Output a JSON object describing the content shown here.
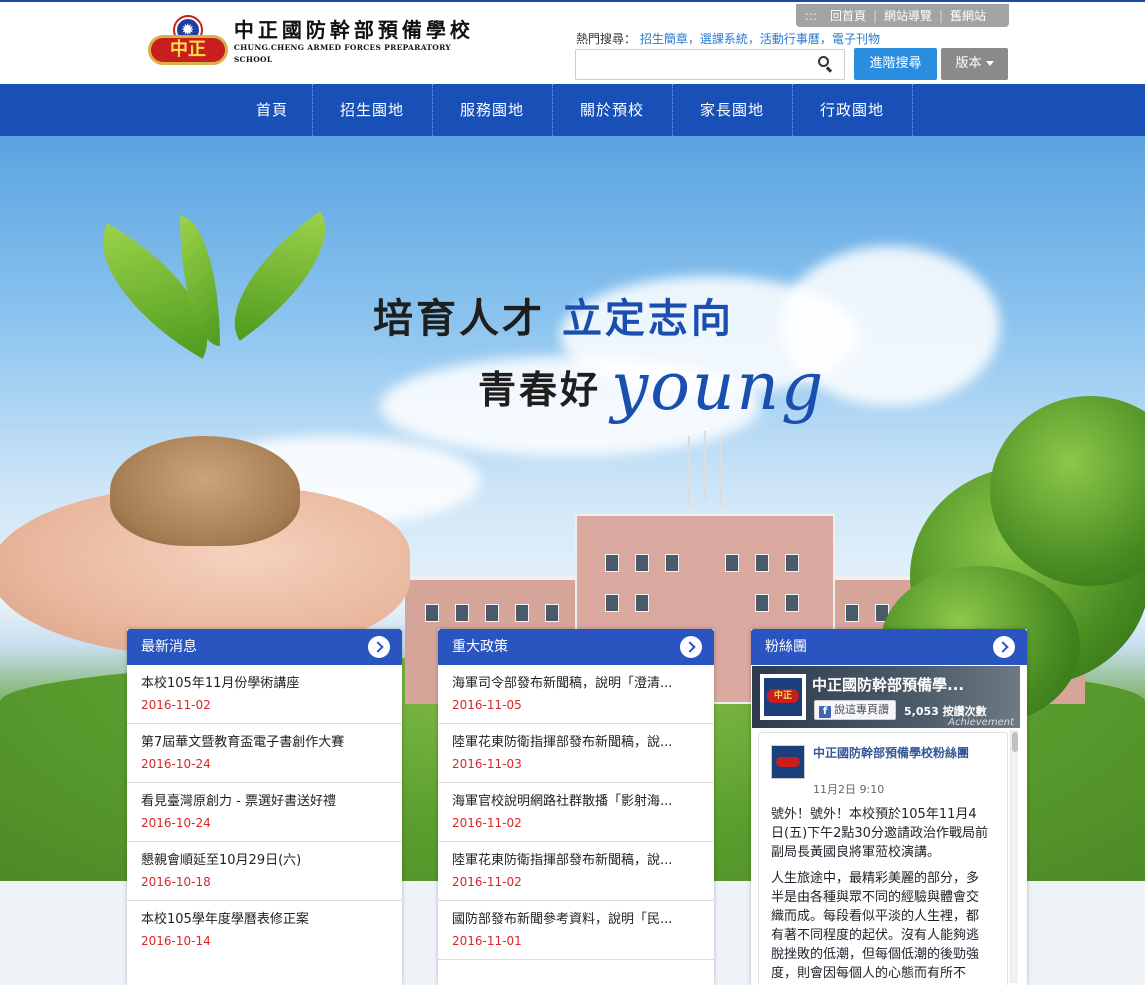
{
  "header": {
    "logo_cn": "中正國防幹部預備學校",
    "logo_en": "CHUNG.CHENG ARMED FORCES PREPARATORY SCHOOL",
    "logo_badge": "中正",
    "toplinks": {
      "dots": ":::",
      "home": "回首頁",
      "sitemap": "網站導覽",
      "old_site": "舊網站"
    },
    "hot_search": {
      "label": "熱門搜尋：",
      "links": [
        "招生簡章",
        "選課系統",
        "活動行事曆",
        "電子刊物"
      ]
    },
    "search": {
      "placeholder": "",
      "value": ""
    },
    "advanced_search_label": "進階搜尋",
    "version_label": "版本"
  },
  "nav": {
    "items": [
      "首頁",
      "招生園地",
      "服務園地",
      "關於預校",
      "家長園地",
      "行政園地"
    ]
  },
  "banner": {
    "slogan_line1_dark": "培育人才",
    "slogan_line1_blue": "立定志向",
    "slogan_line2_dark": "青春好",
    "slogan_line2_script": "young"
  },
  "panels": {
    "news": {
      "title": "最新消息",
      "items": [
        {
          "title": "本校105年11月份學術講座",
          "date": "2016-11-02"
        },
        {
          "title": "第7屆華文暨教育盃電子書創作大賽",
          "date": "2016-10-24"
        },
        {
          "title": "看見臺灣原創力 - 票選好書送好禮",
          "date": "2016-10-24"
        },
        {
          "title": "懇親會順延至10月29日(六)",
          "date": "2016-10-18"
        },
        {
          "title": "本校105學年度學曆表修正案",
          "date": "2016-10-14"
        }
      ]
    },
    "policy": {
      "title": "重大政策",
      "items": [
        {
          "title": "海軍司令部發布新聞稿，說明「澄清...",
          "date": "2016-11-05"
        },
        {
          "title": "陸軍花東防衛指揮部發布新聞稿，說...",
          "date": "2016-11-03"
        },
        {
          "title": "海軍官校說明網路社群散播「影射海...",
          "date": "2016-11-02"
        },
        {
          "title": "陸軍花東防衛指揮部發布新聞稿，說...",
          "date": "2016-11-02"
        },
        {
          "title": "國防部發布新聞參考資料，說明「民...",
          "date": "2016-11-01"
        }
      ]
    },
    "fans": {
      "title": "粉絲團",
      "fb": {
        "page_name": "中正國防幹部預備學...",
        "like_button": "說這專頁讚",
        "like_count": "5,053 按讚次數",
        "cover_caption": "Achievement",
        "post_author": "中正國防幹部預備學校粉絲團",
        "post_time": "11月2日 9:10",
        "post_para1": "號外！號外！本校預於105年11月4日(五)下午2點30分邀請政治作戰局前副局長黃國良將軍蒞校演講。",
        "post_para2": "人生旅途中，最精彩美麗的部分，多半是由各種與眾不同的經驗與體會交織而成。每段看似平淡的人生裡，都有著不同程度的起伏。沒有人能夠逃脫挫敗的低潮，但每個低潮的後勁強度，則會因每個人的心態而有所不同。"
      }
    }
  }
}
